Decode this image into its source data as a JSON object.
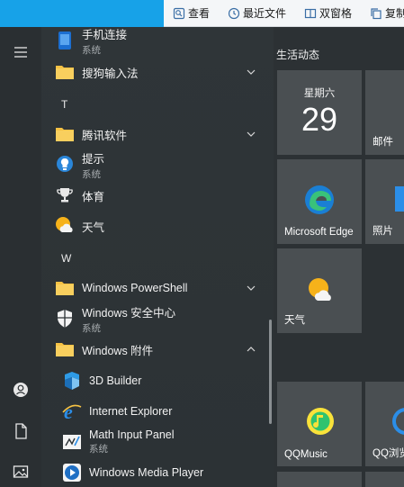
{
  "toolbar": {
    "view": "查看",
    "recent_files": "最近文件",
    "dual_pane": "双窗格",
    "copy": "复制"
  },
  "applist": {
    "items": [
      {
        "name": "手机连接",
        "meta": "系统"
      },
      {
        "name": "搜狗输入法"
      },
      {
        "letter": "T"
      },
      {
        "name": "腾讯软件"
      },
      {
        "name": "提示",
        "meta": "系统"
      },
      {
        "name": "体育"
      },
      {
        "name": "天气"
      },
      {
        "letter": "W"
      },
      {
        "name": "Windows PowerShell"
      },
      {
        "name": "Windows 安全中心",
        "meta": "系统"
      },
      {
        "name": "Windows 附件"
      },
      {
        "name": "3D Builder"
      },
      {
        "name": "Internet Explorer"
      },
      {
        "name": "Math Input Panel",
        "meta": "系统"
      },
      {
        "name": "Windows Media Player"
      }
    ]
  },
  "tiles": {
    "group_title": "生活动态",
    "calendar": {
      "day": "星期六",
      "date": "29"
    },
    "mail": "邮件",
    "edge": "Microsoft Edge",
    "photos": "照片",
    "weather": "天气",
    "qqmusic": "QQMusic",
    "qqbrowser": "QQ浏览"
  },
  "colors": {
    "accent": "#17a2e8",
    "tile_bg": "#4a4f52",
    "list_bg": "#2f3538",
    "folder": "#f6c244"
  }
}
